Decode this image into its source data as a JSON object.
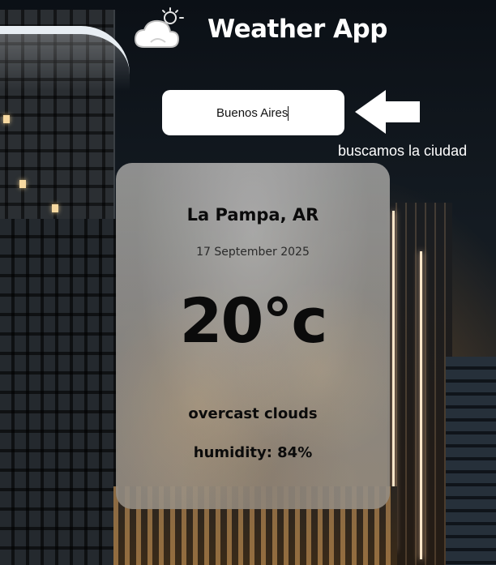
{
  "app": {
    "title": "Weather App",
    "logo_icon": "cloud-sun-icon"
  },
  "search": {
    "value": "Buenos Aires",
    "placeholder": ""
  },
  "annotation": {
    "arrow_icon": "arrow-left-icon",
    "text": "buscamos la ciudad"
  },
  "weather": {
    "location": "La Pampa, AR",
    "date": "17 September 2025",
    "temperature": "20°c",
    "description": "overcast clouds",
    "humidity": "humidity: 84%"
  },
  "colors": {
    "title_text": "#ffffff",
    "card_text": "#0b0b0b",
    "input_bg": "#ffffff"
  }
}
